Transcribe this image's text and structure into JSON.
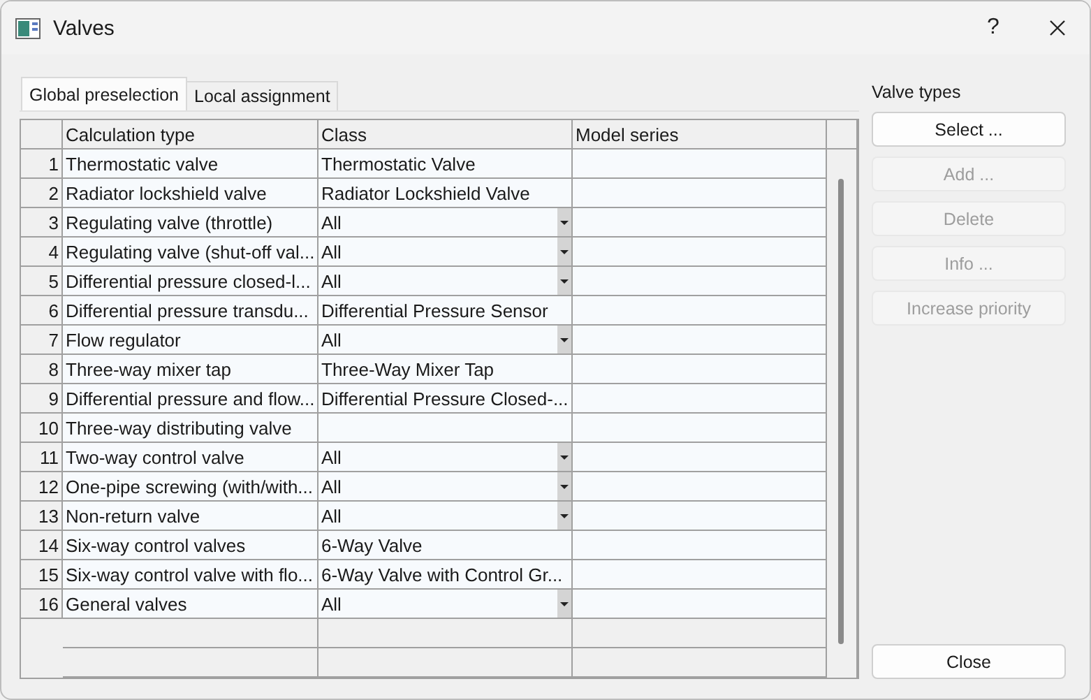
{
  "window": {
    "title": "Valves",
    "help": "?"
  },
  "tabs": [
    {
      "label": "Global preselection",
      "selected": true
    },
    {
      "label": "Local assignment",
      "selected": false
    }
  ],
  "table": {
    "columns": [
      "Calculation type",
      "Class",
      "Model series"
    ],
    "rows": [
      {
        "number": "1",
        "calculation_type": "Thermostatic valve",
        "kind": "text",
        "class": "Thermostatic Valve"
      },
      {
        "number": "2",
        "calculation_type": "Radiator lockshield valve",
        "kind": "text",
        "class": "Radiator Lockshield Valve"
      },
      {
        "number": "3",
        "calculation_type": "Regulating valve (throttle)",
        "kind": "dropdown",
        "class": "All"
      },
      {
        "number": "4",
        "calculation_type": "Regulating valve (shut-off val...",
        "kind": "dropdown",
        "class": "All"
      },
      {
        "number": "5",
        "calculation_type": "Differential pressure closed-l...",
        "kind": "dropdown",
        "class": "All"
      },
      {
        "number": "6",
        "calculation_type": "Differential pressure transdu...",
        "kind": "text",
        "class": "Differential Pressure Sensor"
      },
      {
        "number": "7",
        "calculation_type": "Flow regulator",
        "kind": "dropdown",
        "class": "All"
      },
      {
        "number": "8",
        "calculation_type": "Three-way mixer tap",
        "kind": "text",
        "class": "Three-Way Mixer Tap"
      },
      {
        "number": "9",
        "calculation_type": "Differential pressure and flow...",
        "kind": "text",
        "class": "Differential Pressure Closed-..."
      },
      {
        "number": "10",
        "calculation_type": "Three-way distributing valve",
        "kind": "text"
      },
      {
        "number": "11",
        "calculation_type": "Two-way control valve",
        "kind": "dropdown",
        "class": "All"
      },
      {
        "number": "12",
        "calculation_type": "One-pipe screwing (with/with...",
        "kind": "dropdown",
        "class": "All"
      },
      {
        "number": "13",
        "calculation_type": "Non-return valve",
        "kind": "dropdown",
        "class": "All"
      },
      {
        "number": "14",
        "calculation_type": "Six-way control valves",
        "kind": "text",
        "class": "6-Way Valve"
      },
      {
        "number": "15",
        "calculation_type": "Six-way control valve with flo...",
        "kind": "text",
        "class": "6-Way Valve with Control Gr..."
      },
      {
        "number": "16",
        "calculation_type": "General valves",
        "kind": "dropdown",
        "class": "All"
      }
    ]
  },
  "valve_types": {
    "label": "Valve types",
    "buttons": [
      {
        "label": "Select ...",
        "disabled": false
      },
      {
        "label": "Add ...",
        "disabled": true
      },
      {
        "label": "Delete",
        "disabled": true
      },
      {
        "label": "Info ...",
        "disabled": true
      },
      {
        "label": "Increase priority",
        "disabled": true
      }
    ]
  },
  "close_button": "Close"
}
